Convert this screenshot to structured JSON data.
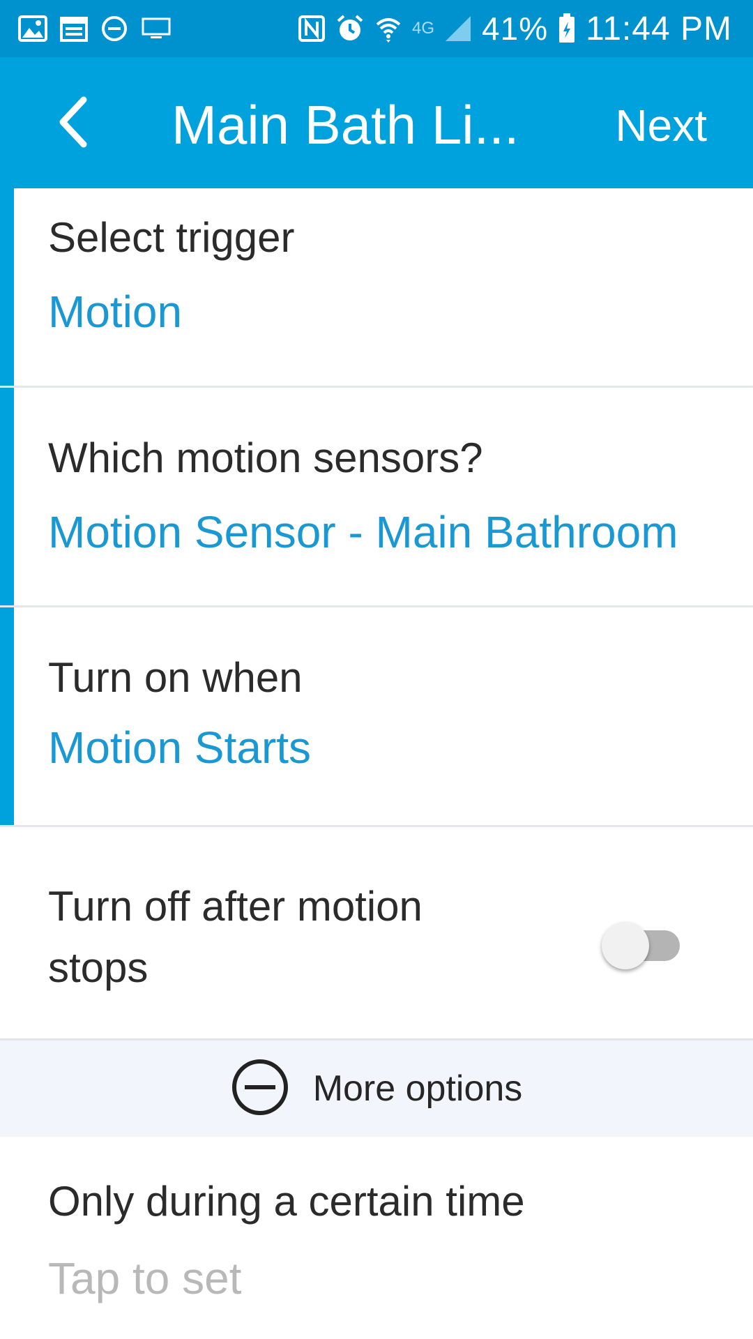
{
  "status_bar": {
    "icons_left": [
      "image-icon",
      "calendar-icon",
      "do-not-disturb-icon",
      "cast-screen-icon"
    ],
    "icons_right": [
      "nfc-icon",
      "alarm-icon",
      "wifi-icon",
      "lte-4g-icon",
      "signal-icon",
      "battery-charging-icon"
    ],
    "network_label": "4G",
    "battery_percent": "41%",
    "time": "11:44 PM"
  },
  "app_bar": {
    "title": "Main Bath Li...",
    "next_label": "Next",
    "background_color": "#00a2de"
  },
  "rows": [
    {
      "title": "Select trigger",
      "value": "Motion"
    },
    {
      "title": "Which motion sensors?",
      "value": "Motion Sensor - Main Bathroom"
    },
    {
      "title": "Turn on when",
      "value": "Motion Starts"
    }
  ],
  "turn_off": {
    "title_line1": "Turn off after motion",
    "title_line2": "stops",
    "toggle_on": false
  },
  "more_options": {
    "label": "More options"
  },
  "time_row": {
    "title": "Only during a certain time",
    "value": "Tap to set"
  },
  "colors": {
    "accent": "#00a2de",
    "value_text": "#1998d3",
    "placeholder_text": "#b8b8b8",
    "status_bar": "#0092cf"
  }
}
